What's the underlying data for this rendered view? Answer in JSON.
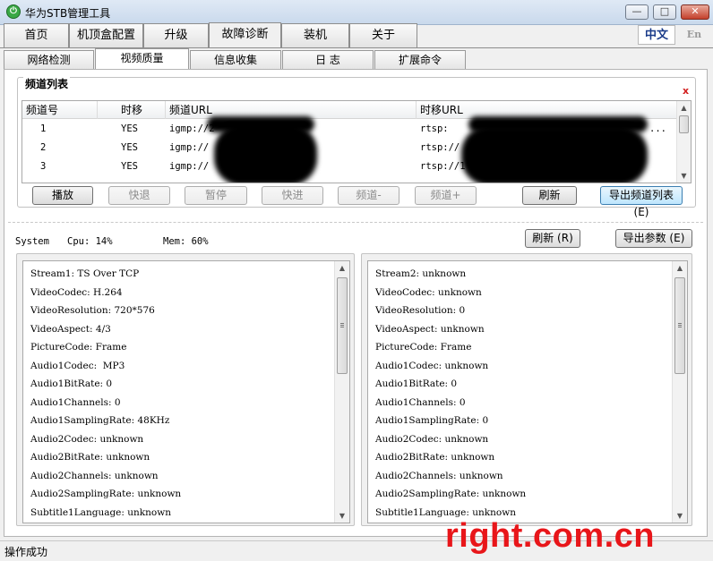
{
  "window": {
    "title": "华为STB管理工具",
    "minimize": "—",
    "maximize": "□",
    "close": "✕",
    "icon_glyph": "⏻"
  },
  "main_tabs": [
    "首页",
    "机顶盒配置",
    "升级",
    "故障诊断",
    "装机",
    "关于"
  ],
  "lang": {
    "cn": "中文",
    "en": "En"
  },
  "sub_tabs": [
    "网络检测",
    "视频质量",
    "信息收集",
    "日 志",
    "扩展命令"
  ],
  "channel_list": {
    "title": "频道列表",
    "close_icon": "x",
    "columns": [
      "频道号",
      "时移",
      "频道URL",
      "时移URL"
    ],
    "rows": [
      {
        "num": "1",
        "timeshift": "YES",
        "url": "igmp://2",
        "ts_url": "rtsp:",
        "tail": "..."
      },
      {
        "num": "2",
        "timeshift": "YES",
        "url": "igmp://",
        "ts_url": "rtsp://",
        "tail": ""
      },
      {
        "num": "3",
        "timeshift": "YES",
        "url": "igmp://",
        "ts_url": "rtsp://1",
        "tail": ""
      }
    ],
    "buttons": {
      "play": "播放",
      "rewind": "快退",
      "pause": "暂停",
      "forward": "快进",
      "ch_down": "频道-",
      "ch_up": "频道+",
      "refresh": "刷新",
      "export": "导出频道列表 (E)"
    }
  },
  "system": {
    "label": "System",
    "cpu": "Cpu: 14%",
    "mem": "Mem: 60%"
  },
  "actions": {
    "refresh": "刷新 (R)",
    "export": "导出参数 (E)"
  },
  "stream1": [
    "Stream1: TS Over TCP",
    "VideoCodec: H.264",
    "VideoResolution: 720*576",
    "VideoAspect: 4/3",
    "PictureCode: Frame",
    "Audio1Codec:  MP3",
    "Audio1BitRate: 0",
    "Audio1Channels: 0",
    "Audio1SamplingRate: 48KHz",
    "Audio2Codec: unknown",
    "Audio2BitRate: unknown",
    "Audio2Channels: unknown",
    "Audio2SamplingRate: unknown",
    "Subtitle1Language: unknown"
  ],
  "stream2": [
    "Stream2: unknown",
    "VideoCodec: unknown",
    "VideoResolution: 0",
    "VideoAspect: unknown",
    "PictureCode: Frame",
    "Audio1Codec: unknown",
    "Audio1BitRate: 0",
    "Audio1Channels: 0",
    "Audio1SamplingRate: 0",
    "Audio2Codec: unknown",
    "Audio2BitRate: unknown",
    "Audio2Channels: unknown",
    "Audio2SamplingRate: unknown",
    "Subtitle1Language: unknown"
  ],
  "status": "操作成功",
  "watermark": "right.com.cn",
  "colors": {
    "accent": "#3c7fb1",
    "close_red": "#c4402c",
    "watermark": "#e8161a",
    "lang_blue": "#1b3c8a"
  }
}
